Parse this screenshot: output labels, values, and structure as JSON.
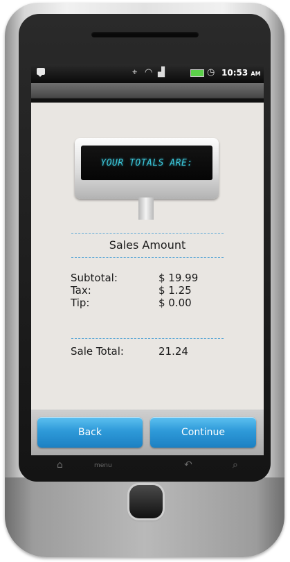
{
  "status_bar": {
    "time": "10:53",
    "ampm": "AM",
    "icons": [
      "message-icon",
      "gps-icon",
      "wifi-icon",
      "signal-icon",
      "battery-icon",
      "alarm-icon"
    ]
  },
  "display": {
    "text": "YOUR TOTALS ARE:"
  },
  "section": {
    "title": "Sales Amount"
  },
  "lines": [
    {
      "label": "Subtotal:",
      "value": "$ 19.99"
    },
    {
      "label": "Tax:",
      "value": "$ 1.25"
    },
    {
      "label": "Tip:",
      "value": "$ 0.00"
    }
  ],
  "total": {
    "label": "Sale Total:",
    "value": "21.24"
  },
  "buttons": {
    "back": "Back",
    "continue": "Continue"
  },
  "hardware": {
    "menu": "menu"
  },
  "colors": {
    "accent": "#2e9ad9",
    "lcd_text": "#3bc6d9",
    "divider": "#5ba7d6"
  }
}
